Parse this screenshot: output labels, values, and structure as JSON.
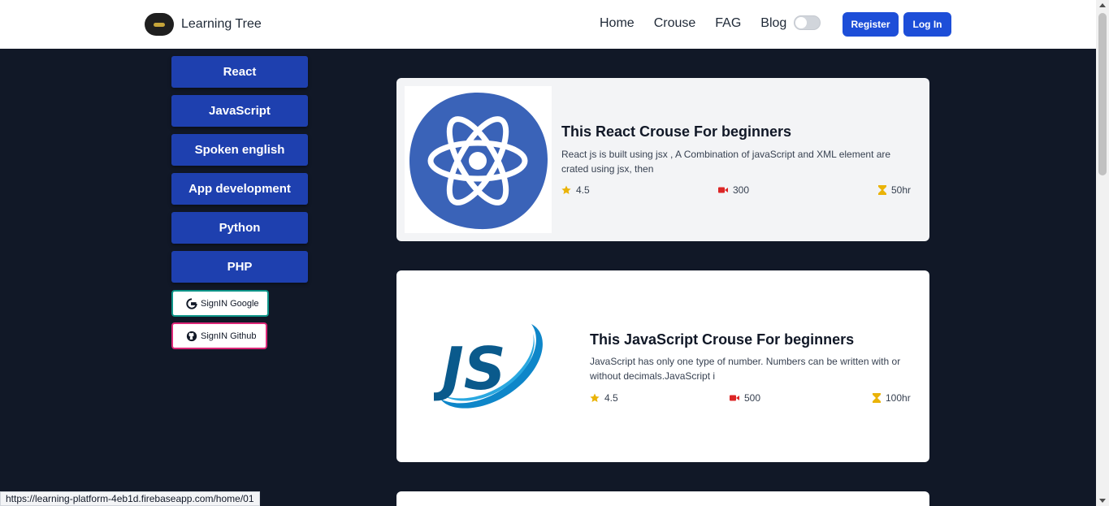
{
  "brand": {
    "name": "Learning Tree"
  },
  "nav": {
    "links": [
      "Home",
      "Crouse",
      "FAG",
      "Blog"
    ],
    "register": "Register",
    "login": "Log In"
  },
  "sidebar": {
    "categories": [
      "React",
      "JavaScript",
      "Spoken english",
      "App development",
      "Python",
      "PHP"
    ],
    "sign_google": "SignIN Google",
    "sign_github": "SignIN Github"
  },
  "courses": [
    {
      "title": "This React Crouse For beginners",
      "description": "React js is built using jsx , A Combination of javaScript and XML element are crated using jsx, then",
      "rating": "4.5",
      "videos": "300",
      "duration": "50hr"
    },
    {
      "title": "This JavaScript Crouse For beginners",
      "description": "JavaScript has only one type of number. Numbers can be written with or without decimals.JavaScript i",
      "rating": "4.5",
      "videos": "500",
      "duration": "100hr"
    }
  ],
  "status_url": "https://learning-platform-4eb1d.firebaseapp.com/home/01",
  "colors": {
    "primary": "#1d4ed8",
    "sidebar_button": "#1e40af",
    "background": "#111827",
    "star": "#eab308",
    "video": "#dc2626"
  }
}
